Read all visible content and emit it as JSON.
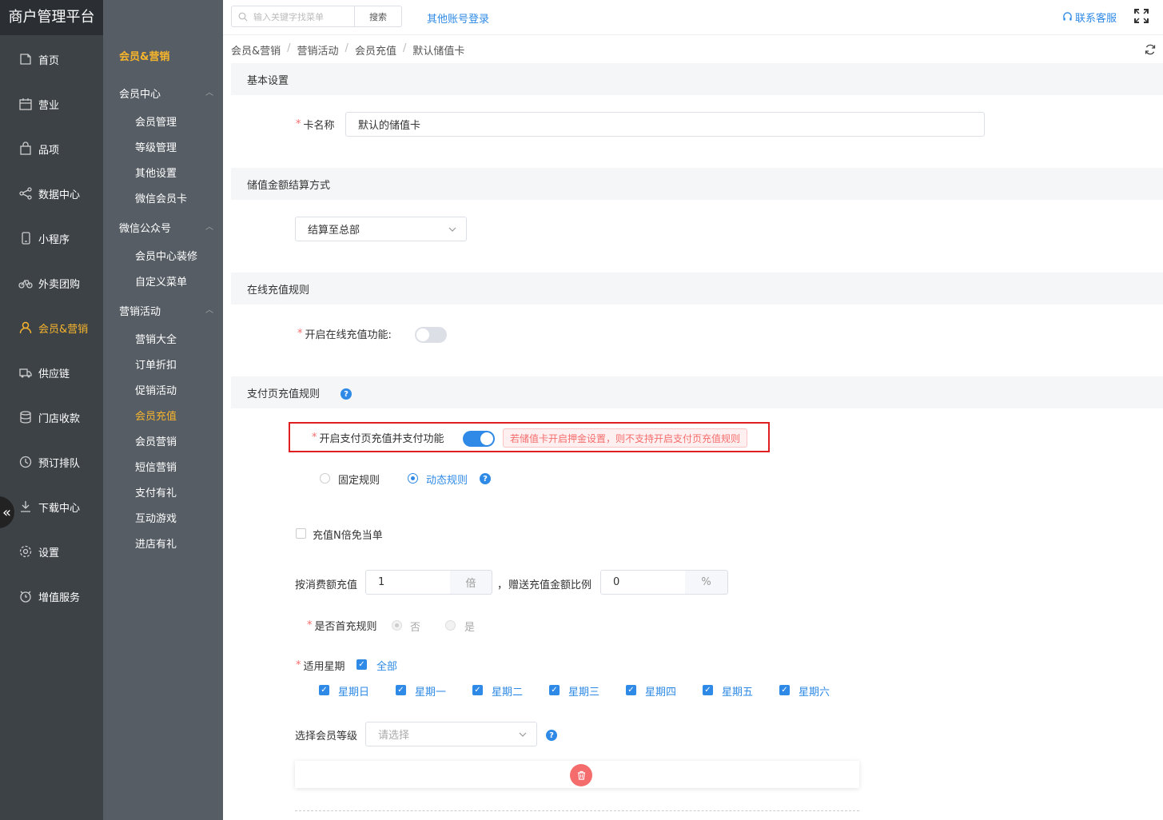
{
  "app_title": "商户管理平台",
  "nav": [
    {
      "label": "首页",
      "icon": "home-icon"
    },
    {
      "label": "营业",
      "icon": "calendar-icon"
    },
    {
      "label": "品项",
      "icon": "bag-icon"
    },
    {
      "label": "数据中心",
      "icon": "share-icon"
    },
    {
      "label": "小程序",
      "icon": "phone-icon"
    },
    {
      "label": "外卖团购",
      "icon": "bike-icon"
    },
    {
      "label": "会员&营销",
      "icon": "user-icon",
      "active": true
    },
    {
      "label": "供应链",
      "icon": "truck-icon"
    },
    {
      "label": "门店收款",
      "icon": "database-icon"
    },
    {
      "label": "预订排队",
      "icon": "clock-icon"
    },
    {
      "label": "下载中心",
      "icon": "download-icon"
    },
    {
      "label": "设置",
      "icon": "gear-icon"
    },
    {
      "label": "增值服务",
      "icon": "alarm-icon"
    }
  ],
  "submenu": {
    "title": "会员&营销",
    "groups": [
      {
        "label": "会员中心",
        "items": [
          "会员管理",
          "等级管理",
          "其他设置",
          "微信会员卡"
        ]
      },
      {
        "label": "微信公众号",
        "items": [
          "会员中心装修",
          "自定义菜单"
        ]
      },
      {
        "label": "营销活动",
        "items": [
          "营销大全",
          "订单折扣",
          "促销活动",
          "会员充值",
          "会员营销",
          "短信营销",
          "支付有礼",
          "互动游戏",
          "进店有礼"
        ]
      }
    ],
    "active_item": "会员充值"
  },
  "topbar": {
    "search_placeholder": "输入关键字找菜单",
    "search_button": "搜索",
    "other_login": "其他账号登录",
    "contact": "联系客服"
  },
  "breadcrumb": [
    "会员&营销",
    "营销活动",
    "会员充值",
    "默认储值卡"
  ],
  "form": {
    "section_basic": "基本设置",
    "card_name_label": "卡名称",
    "card_name_value": "默认的储值卡",
    "section_settlement": "储值金额结算方式",
    "settlement_value": "结算至总部",
    "section_online": "在线充值规则",
    "online_label": "开启在线充值功能:",
    "online_enabled": false,
    "section_paypage": "支付页充值规则",
    "paypage_label": "开启支付页充值并支付功能",
    "paypage_enabled": true,
    "paypage_warning": "若储值卡开启押金设置，则不支持开启支付页充值规则",
    "rule_fixed": "固定规则",
    "rule_dynamic": "动态规则",
    "rule_selected": "动态规则",
    "free_order_label": "充值N倍免当单",
    "free_order_checked": false,
    "recharge_label": "按消费额充值",
    "recharge_value": "1",
    "recharge_unit": "倍",
    "comma": "，",
    "gift_label": "赠送充值金额比例",
    "gift_value": "0",
    "gift_unit": "%",
    "first_label": "是否首充规则",
    "first_no": "否",
    "first_yes": "是",
    "weekday_label": "适用星期",
    "weekday_all": "全部",
    "weekdays": [
      "星期日",
      "星期一",
      "星期二",
      "星期三",
      "星期四",
      "星期五",
      "星期六"
    ],
    "level_label": "选择会员等级",
    "level_placeholder": "请选择"
  },
  "colors": {
    "accent": "#2e8ae6",
    "active_nav": "#f7b52c",
    "warning": "#f56c6c",
    "highlight_border": "#e02020"
  }
}
